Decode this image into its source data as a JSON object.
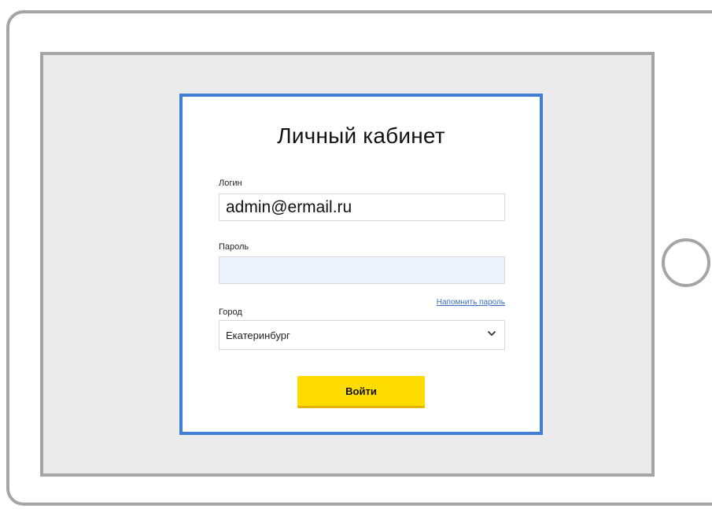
{
  "card": {
    "title": "Личный кабинет"
  },
  "login": {
    "label": "Логин",
    "value": "admin@ermail.ru"
  },
  "password": {
    "label": "Пароль",
    "value": "",
    "remind_link": "Напомнить пароль"
  },
  "city": {
    "label": "Город",
    "selected": "Екатеринбург"
  },
  "submit": {
    "label": "Войти"
  },
  "colors": {
    "card_border": "#3f7fd6",
    "button": "#ffdc00",
    "link": "#3a6fc2",
    "password_field_bg": "#eef4fd"
  },
  "icons": {
    "select_arrow": "chevron-down-icon"
  }
}
